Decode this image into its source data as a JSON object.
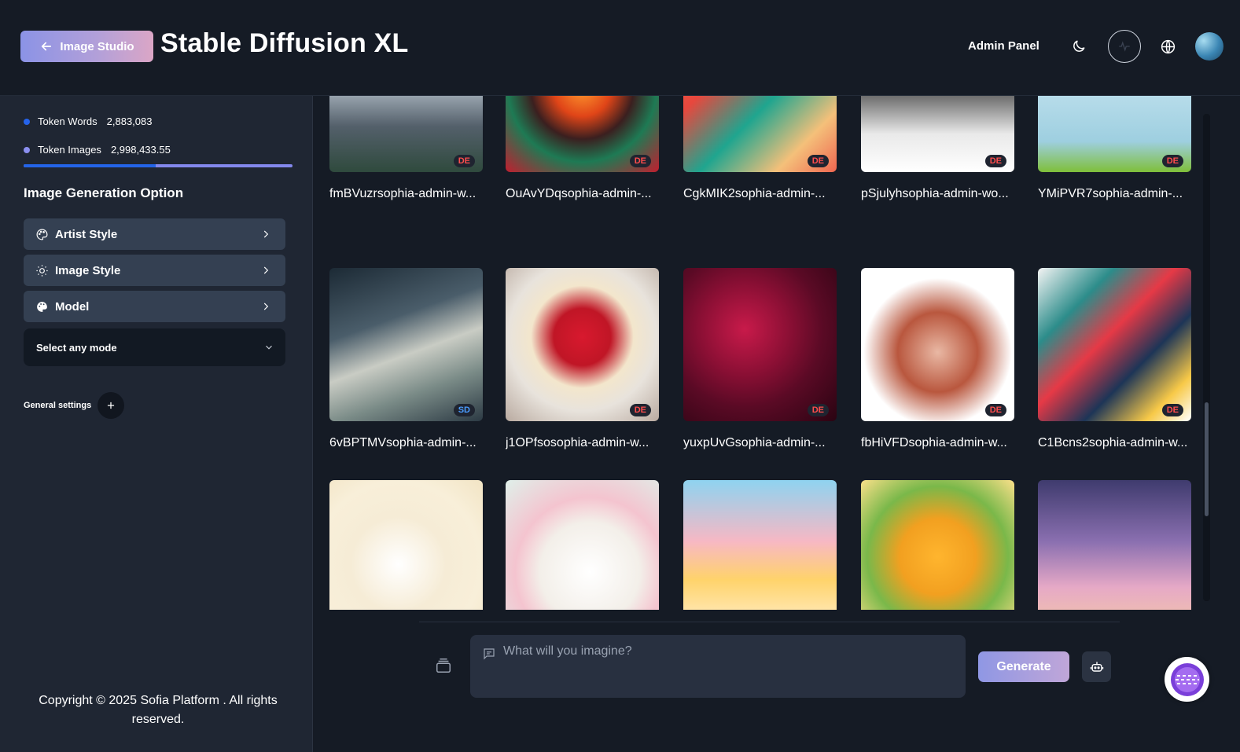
{
  "header": {
    "back_label": "Image Studio",
    "title": "Stable Diffusion XL",
    "admin_label": "Admin Panel"
  },
  "sidebar": {
    "tokens": [
      {
        "label": "Token Words",
        "value": "2,883,083",
        "dot_color": "#2563eb"
      },
      {
        "label": "Token Images",
        "value": "2,998,433.55",
        "dot_color": "#8b8ff0"
      }
    ],
    "token_progress_percent": 49,
    "section_title": "Image Generation Option",
    "options": [
      {
        "label": "Artist Style",
        "icon": "palette-icon"
      },
      {
        "label": "Image Style",
        "icon": "sun-icon"
      },
      {
        "label": "Model",
        "icon": "palette-fill-icon"
      }
    ],
    "mode_select": "Select any mode",
    "general_settings": "General settings",
    "copyright": "Copyright © 2025 Sofia Platform . All rights reserved."
  },
  "gallery": {
    "items": [
      {
        "caption": "fmBVuzrsophia-admin-w...",
        "badge": "DE",
        "bg": "linear-gradient(180deg,#dfe3e8 0%,#a9b4be 45%,#54606b 70%,#2f4a3d 100%)"
      },
      {
        "caption": "OuAvYDqsophia-admin-...",
        "badge": "DE",
        "bg": "radial-gradient(circle at 50% 45%,#ff9a2e 0%,#e04518 25%,#3b1f1f 45%,#1e7a54 65%,#c21e2f 100%)"
      },
      {
        "caption": "CgkMIK2sophia-admin-...",
        "badge": "DE",
        "bg": "linear-gradient(135deg,#f26d4f 0%,#e8473d 30%,#1fa58f 55%,#f4c07a 80%,#ef6650 100%)"
      },
      {
        "caption": "pSjulyhsophia-admin-wo...",
        "badge": "DE",
        "bg": "linear-gradient(180deg,#6b6b6b 0%,#3a3a3a 40%,#e9e9e9 75%,#ffffff 100%)"
      },
      {
        "caption": "YMiPVR7sophia-admin-...",
        "badge": "DE",
        "bg": "linear-gradient(180deg,#d8eef5 0%,#b7dcea 50%,#9ecfe0 80%,#7fbf3a 100%)"
      },
      {
        "caption": "6vBPTMVsophia-admin-...",
        "badge": "SD",
        "bg": "linear-gradient(160deg,#1c2a35 0%,#4a5d6a 35%,#c9ccc4 55%,#7a8b87 75%,#2c3a44 100%)"
      },
      {
        "caption": "j1OPfsosophia-admin-w...",
        "badge": "DE",
        "bg": "radial-gradient(circle at 50% 45%,#d8192e 0%,#c01626 25%,#f3e6cc 45%,#e8e3dc 65%,#b9aaa0 100%)"
      },
      {
        "caption": "yuxpUvGsophia-admin-...",
        "badge": "DE",
        "bg": "radial-gradient(circle at 40% 40%,#c81a4a 0%,#8a0f34 35%,#5a0a25 60%,#2a0412 100%)"
      },
      {
        "caption": "fbHiVFDsophia-admin-w...",
        "badge": "DE",
        "bg": "radial-gradient(circle at 50% 55%,#e9b8a4 0%,#b9573e 35%,#ffffff 65%,#ffffff 100%)"
      },
      {
        "caption": "C1Bcns2sophia-admin-w...",
        "badge": "DE",
        "bg": "linear-gradient(135deg,#f4f4f4 0%,#2c8c8a 25%,#e63946 45%,#1d3557 65%,#f7c948 85%,#ffffff 100%)"
      },
      {
        "caption": "",
        "badge": "",
        "bg": "radial-gradient(circle at 45% 55%,#ffffff 0%,#f6ecd6 40%,#f8efd9 70%,#f2e4c4 100%)"
      },
      {
        "caption": "",
        "badge": "",
        "bg": "radial-gradient(circle at 55% 60%,#ffffff 0%,#f3efe9 40%,#f4c4cf 60%,#dff0ea 100%)"
      },
      {
        "caption": "",
        "badge": "",
        "bg": "linear-gradient(180deg,#8fd3f0 0%,#f7b8c4 40%,#ffd36b 65%,#fff1d4 100%)"
      },
      {
        "caption": "",
        "badge": "",
        "bg": "radial-gradient(circle at 50% 50%,#ffb52e 0%,#f2a020 35%,#7ab84a 65%,#fbe08a 100%)"
      },
      {
        "caption": "",
        "badge": "",
        "bg": "linear-gradient(180deg,#3f3b6e 0%,#8a6fb0 40%,#e6a9c6 70%,#f4c9a6 100%)"
      }
    ]
  },
  "composer": {
    "placeholder": "What will you imagine?",
    "generate_label": "Generate"
  }
}
